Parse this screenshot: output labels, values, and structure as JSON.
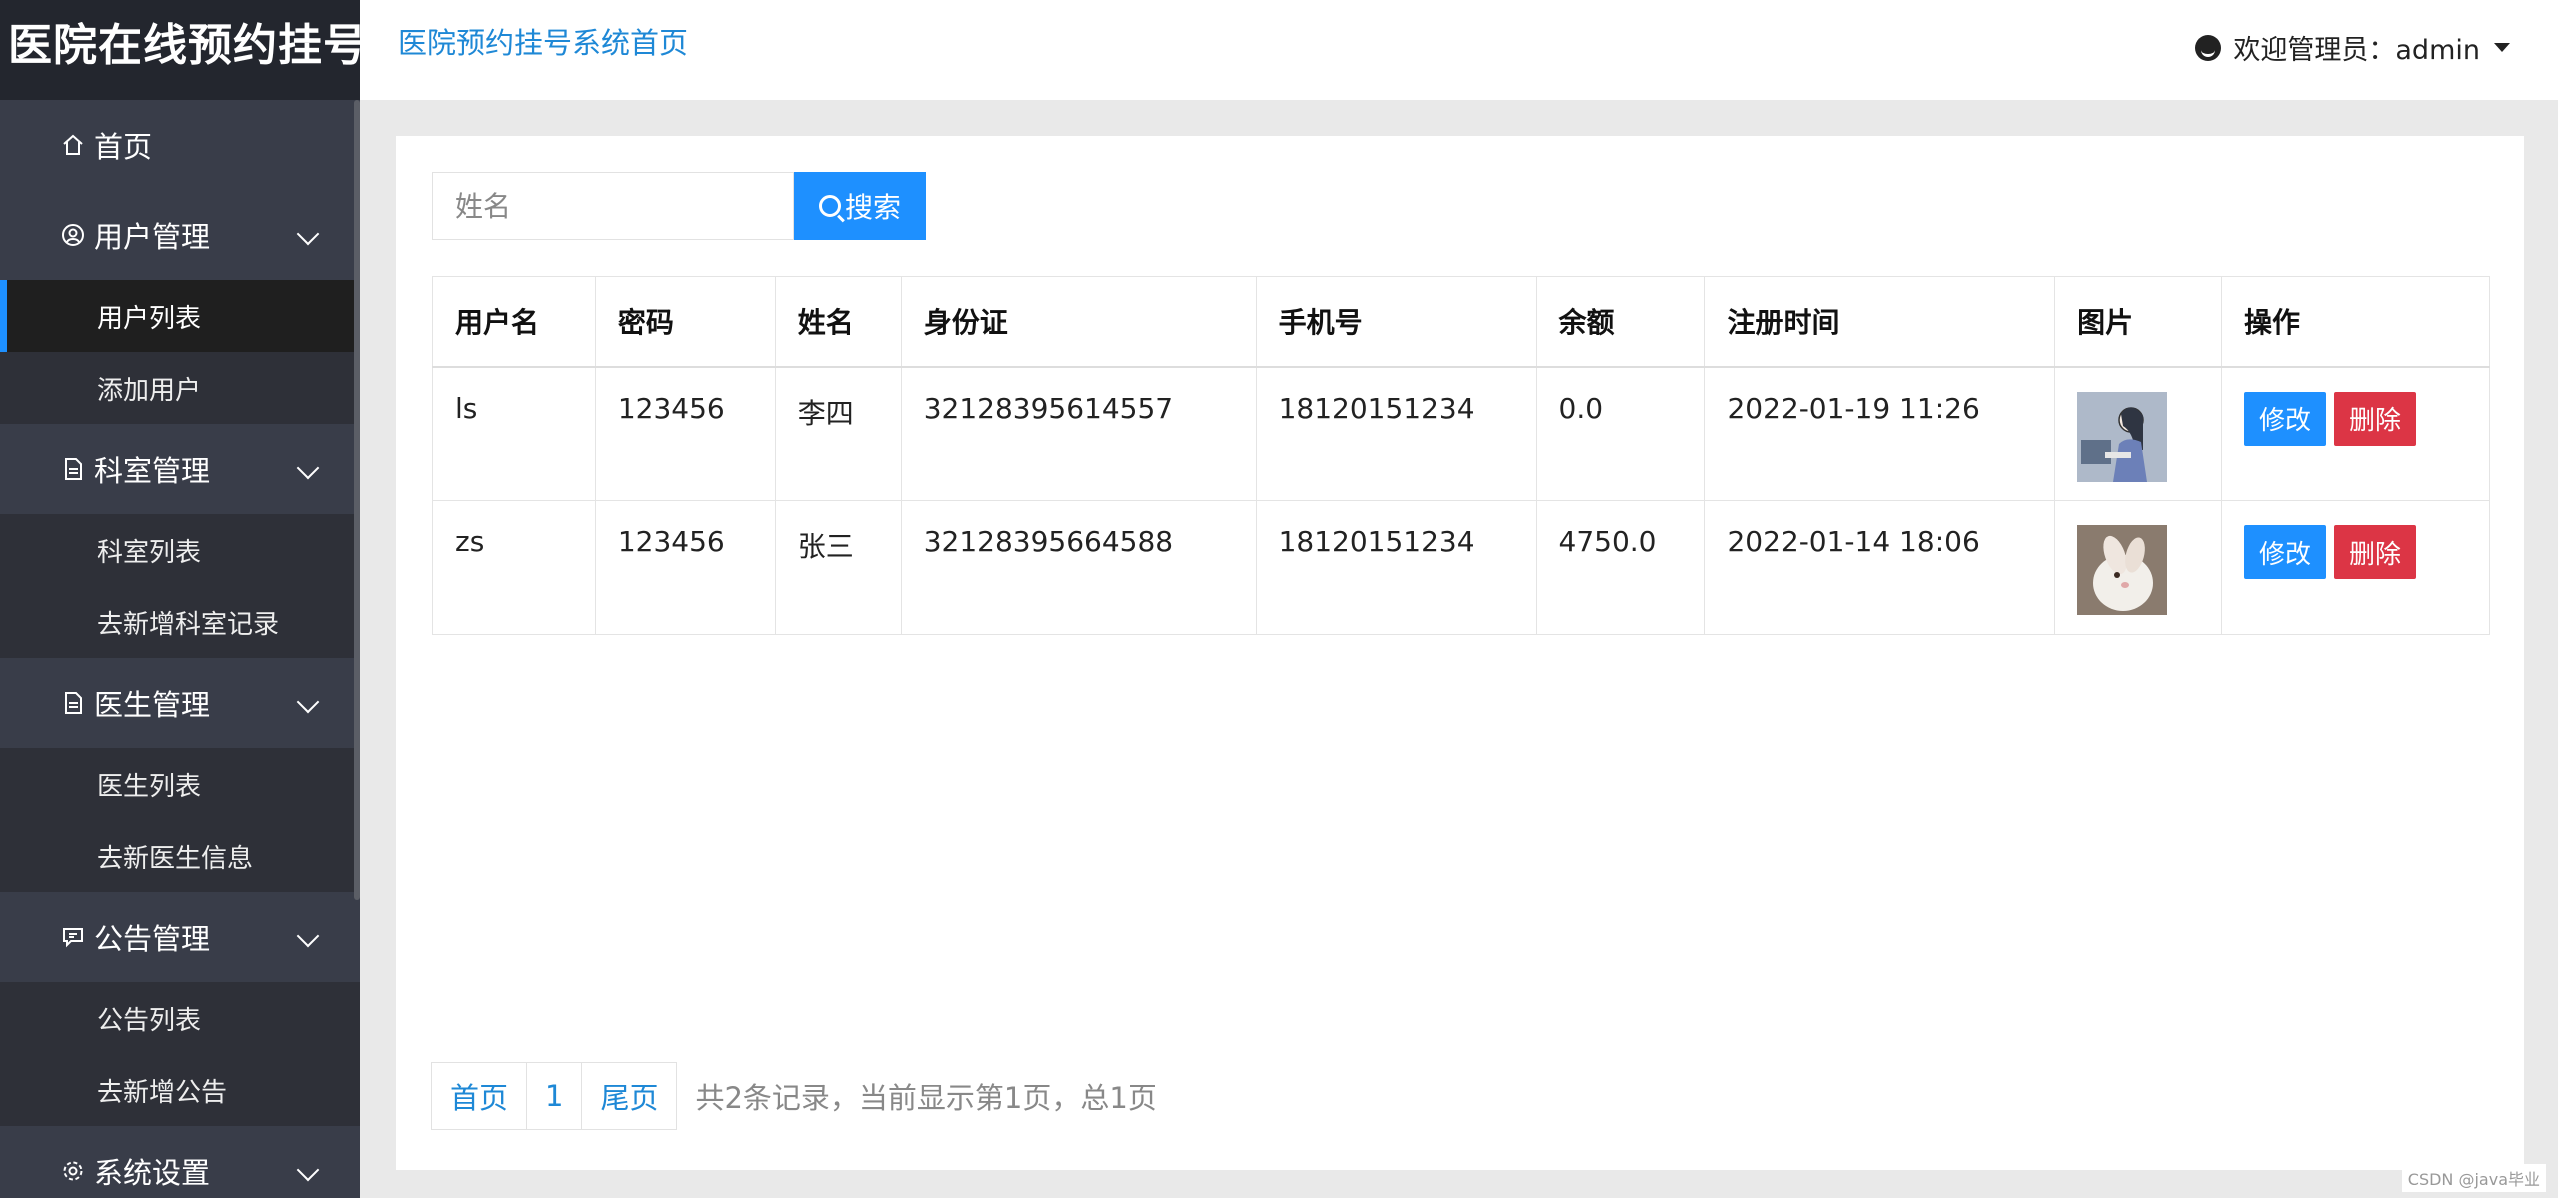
{
  "app_title": "医院在线预约挂号",
  "header": {
    "home_link": "医院预约挂号系统首页",
    "user_label": "欢迎管理员：admin"
  },
  "sidebar": {
    "home": "首页",
    "groups": [
      {
        "label": "用户管理",
        "icon": "user-circle-icon",
        "items": [
          "用户列表",
          "添加用户"
        ]
      },
      {
        "label": "科室管理",
        "icon": "document-icon",
        "items": [
          "科室列表",
          "去新增科室记录"
        ]
      },
      {
        "label": "医生管理",
        "icon": "document-icon",
        "items": [
          "医生列表",
          "去新医生信息"
        ]
      },
      {
        "label": "公告管理",
        "icon": "message-icon",
        "items": [
          "公告列表",
          "去新增公告"
        ]
      },
      {
        "label": "系统设置",
        "icon": "gear-icon",
        "items": []
      }
    ],
    "active_item": "用户列表"
  },
  "search": {
    "placeholder": "姓名",
    "button_label": "搜索"
  },
  "table": {
    "columns": [
      "用户名",
      "密码",
      "姓名",
      "身份证",
      "手机号",
      "余额",
      "注册时间",
      "图片",
      "操作"
    ],
    "rows": [
      {
        "username": "ls",
        "password": "123456",
        "name": "李四",
        "id_card": "32128395614557",
        "phone": "18120151234",
        "balance": "0.0",
        "registered": "2022-01-19 11:26",
        "image": "woman-at-computer-illustration",
        "edit": "修改",
        "delete": "删除"
      },
      {
        "username": "zs",
        "password": "123456",
        "name": "张三",
        "id_card": "32128395664588",
        "phone": "18120151234",
        "balance": "4750.0",
        "registered": "2022-01-14 18:06",
        "image": "white-rabbit-photo",
        "edit": "修改",
        "delete": "删除"
      }
    ]
  },
  "pagination": {
    "first": "首页",
    "page": "1",
    "last": "尾页",
    "info": "共2条记录，当前显示第1页，总1页"
  },
  "watermark": "CSDN @java毕业",
  "colors": {
    "sidebar": "#393d49",
    "primary": "#1e90ff",
    "danger": "#dc3545",
    "link": "#1e88d6"
  }
}
